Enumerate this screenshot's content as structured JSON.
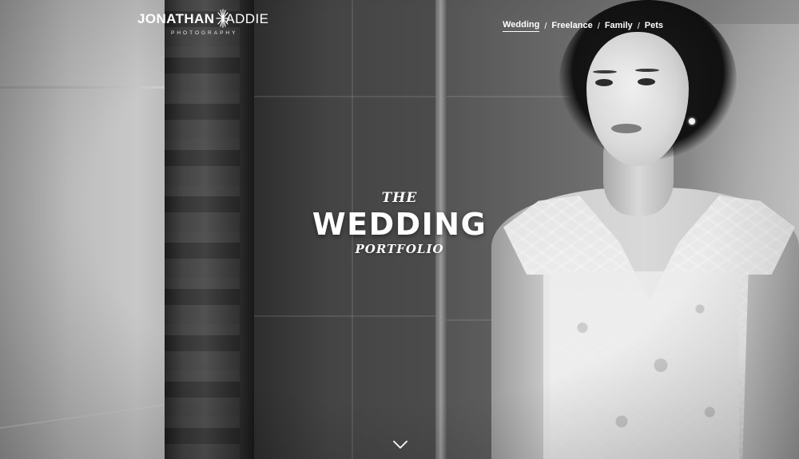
{
  "brand": {
    "name_bold": "JONATHAN",
    "name_light": "ADDIE",
    "tagline": "PHOTOGRAPHY"
  },
  "nav": {
    "items": [
      {
        "label": "Wedding",
        "active": true
      },
      {
        "label": "Freelance",
        "active": false
      },
      {
        "label": "Family",
        "active": false
      },
      {
        "label": "Pets",
        "active": false
      }
    ],
    "separator": "/"
  },
  "hero": {
    "pre": "THE",
    "main": "WEDDING",
    "post": "PORTFOLIO"
  },
  "scroll": {
    "icon": "chevron-down-icon"
  },
  "colors": {
    "text": "#ffffff",
    "photo_tone": "monochrome"
  }
}
